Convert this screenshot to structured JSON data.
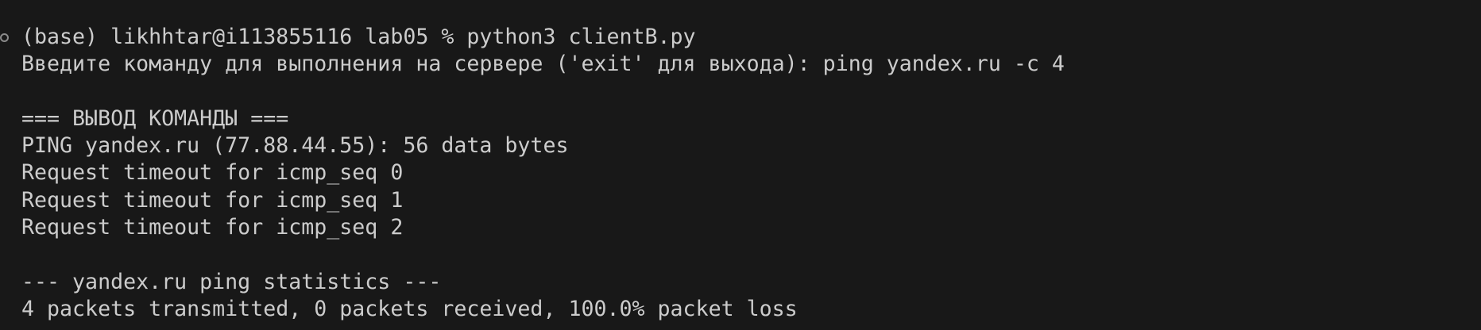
{
  "terminal": {
    "lines": [
      "(base) likhhtar@i113855116 lab05 % python3 clientB.py",
      "Введите команду для выполнения на сервере ('exit' для выхода): ping yandex.ru -c 4",
      "",
      "=== ВЫВОД КОМАНДЫ ===",
      "PING yandex.ru (77.88.44.55): 56 data bytes",
      "Request timeout for icmp_seq 0",
      "Request timeout for icmp_seq 1",
      "Request timeout for icmp_seq 2",
      "",
      "--- yandex.ru ping statistics ---",
      "4 packets transmitted, 0 packets received, 100.0% packet loss"
    ],
    "colors": {
      "background": "#181818",
      "foreground": "#cccccc",
      "decoration": "#8a8a8a"
    },
    "icons": {
      "command_decoration": "circle-outline-icon"
    }
  }
}
